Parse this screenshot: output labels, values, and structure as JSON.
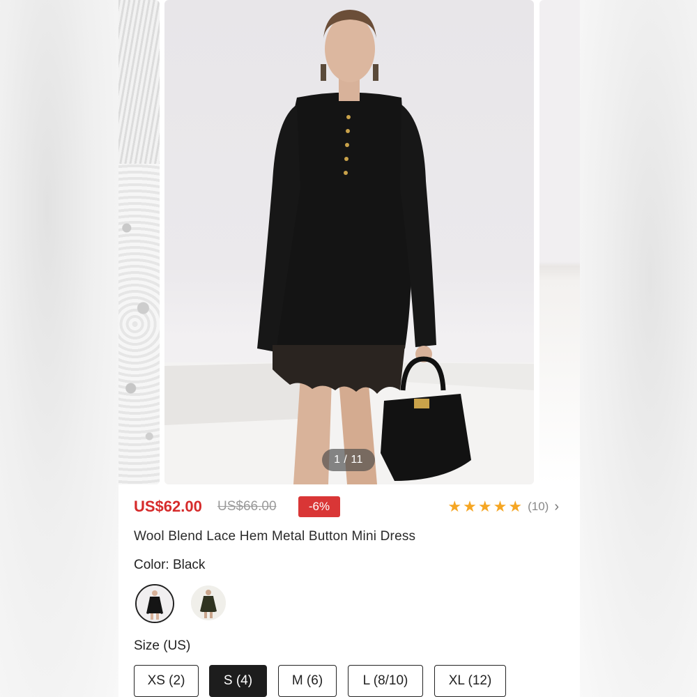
{
  "gallery": {
    "counter": "1 / 11"
  },
  "product": {
    "price": "US$62.00",
    "original_price": "US$66.00",
    "discount": "-6%",
    "rating_stars": 5,
    "rating_count": "(10)",
    "title": "Wool Blend Lace Hem Metal Button Mini Dress"
  },
  "color": {
    "label": "Color: Black",
    "options": [
      {
        "icon": "black-dress-swatch",
        "selected": true
      },
      {
        "icon": "olive-dress-swatch",
        "selected": false
      }
    ]
  },
  "size": {
    "label": "Size (US)",
    "options": [
      {
        "label": "XS (2)",
        "selected": false
      },
      {
        "label": "S (4)",
        "selected": true
      },
      {
        "label": "M (6)",
        "selected": false
      },
      {
        "label": "L (8/10)",
        "selected": false
      },
      {
        "label": "XL (12)",
        "selected": false
      }
    ]
  },
  "colors": {
    "sale_red": "#d62b2b",
    "discount_badge": "#d93636",
    "star": "#f5a623",
    "selected_size_bg": "#1d1d1d"
  }
}
